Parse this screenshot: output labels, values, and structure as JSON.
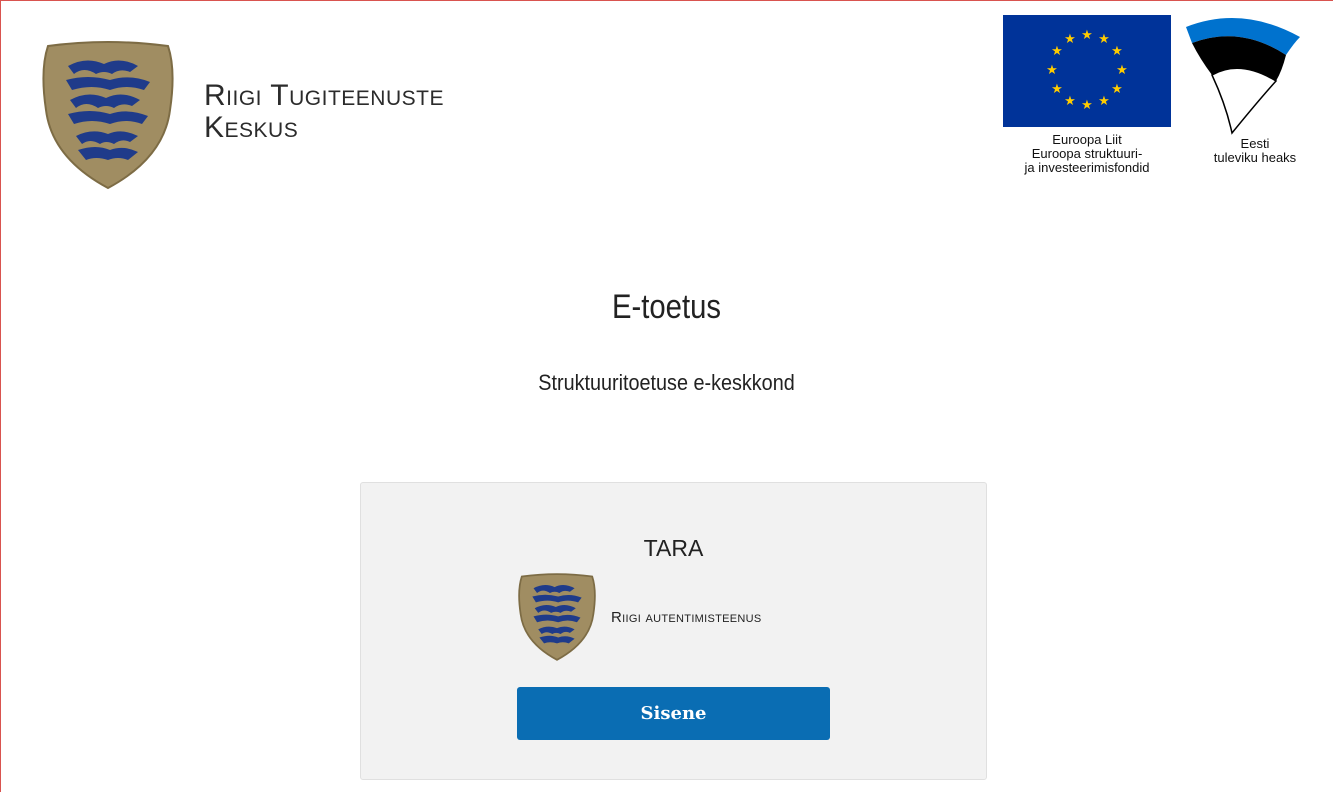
{
  "header": {
    "org_name_line1": "Riigi Tugiteenuste",
    "org_name_line2": "Keskus",
    "eu_caption_line1": "Euroopa Liit",
    "eu_caption_line2": "Euroopa struktuuri-",
    "eu_caption_line3": "ja investeerimisfondid",
    "ee_caption_line1": "Eesti",
    "ee_caption_line2": "tuleviku heaks"
  },
  "main": {
    "title": "E-toetus",
    "subtitle": "Struktuuritoetuse e-keskkond"
  },
  "login": {
    "provider_title": "TARA",
    "service_label": "Riigi autentimisteenus",
    "button_label": "Sisene"
  },
  "colors": {
    "accent": "#0a6db3",
    "eu_blue": "#003399",
    "eu_star": "#ffcc00",
    "crest_gold": "#a08d62",
    "crest_lion": "#1f3b8a",
    "ee_blue": "#0072ce",
    "frame_red": "#d9534f"
  },
  "icons": {
    "crest": "estonian-coat-of-arms-icon",
    "eu_flag": "eu-flag-icon",
    "ee_flag": "estonian-flag-icon"
  }
}
